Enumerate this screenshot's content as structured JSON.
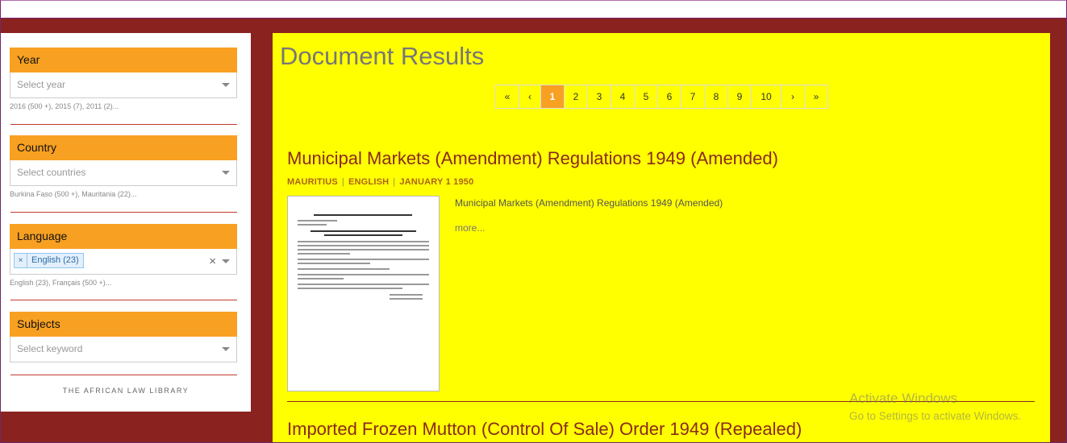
{
  "sidebar": {
    "facets": [
      {
        "title": "Year",
        "placeholder": "Select year",
        "hint": "2016 (500 +), 2015 (7), 2011 (2)..."
      },
      {
        "title": "Country",
        "placeholder": "Select countries",
        "hint": "Burkina Faso (500 +), Mauritania (22)..."
      },
      {
        "title": "Language",
        "selected_tag": "English (23)",
        "tag_remove": "×",
        "clear": "×",
        "hint": "English (23), Français (500 +)..."
      },
      {
        "title": "Subjects",
        "placeholder": "Select keyword",
        "hint": ""
      }
    ],
    "library_name": "THE AFRICAN LAW LIBRARY"
  },
  "main": {
    "title": "Document Results",
    "pagination": {
      "first": "«",
      "prev": "‹",
      "next": "›",
      "last": "»",
      "pages": [
        "1",
        "2",
        "3",
        "4",
        "5",
        "6",
        "7",
        "8",
        "9",
        "10"
      ],
      "current": "1"
    },
    "results": [
      {
        "title": "Municipal Markets (Amendment) Regulations 1949 (Amended)",
        "country": "MAURITIUS",
        "language": "ENGLISH",
        "date": "JANUARY 1 1950",
        "separator": "|",
        "summary": "Municipal Markets (Amendment) Regulations 1949 (Amended)",
        "more": "more..."
      },
      {
        "title": "Imported Frozen Mutton (Control Of Sale) Order 1949 (Repealed)"
      }
    ]
  },
  "os_watermark": {
    "line1": "Activate Windows",
    "line2": "Go to Settings to activate Windows."
  }
}
